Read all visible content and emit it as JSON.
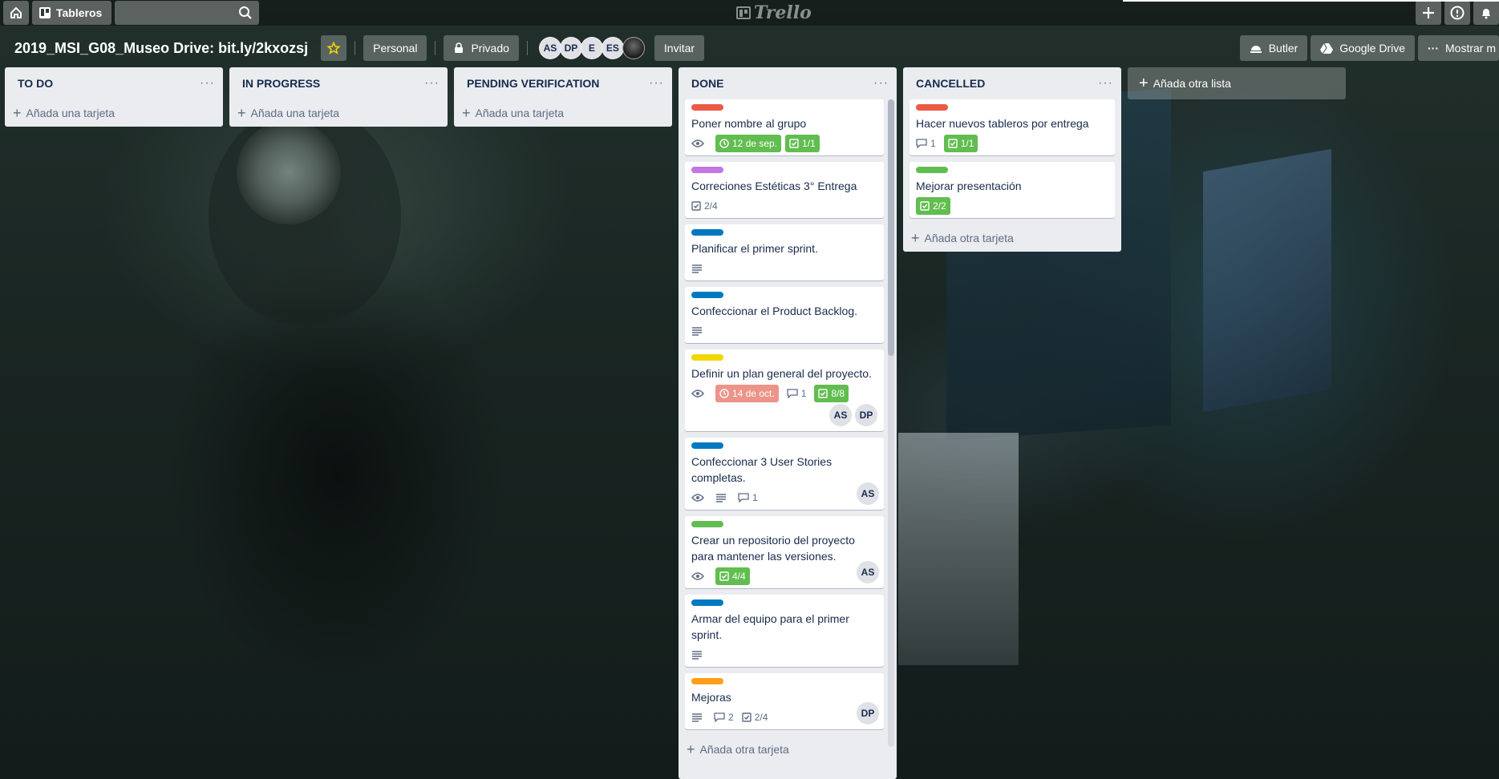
{
  "topbar": {
    "boards_label": "Tableros",
    "search_placeholder": "",
    "logo_text": "Trello"
  },
  "board": {
    "title": "2019_MSI_G08_Museo Drive: bit.ly/2kxozsj",
    "team_label": "Personal",
    "visibility_label": "Privado",
    "members": [
      "AS",
      "DP",
      "E",
      "ES"
    ],
    "invite_label": "Invitar",
    "butler_label": "Butler",
    "drive_label": "Google Drive",
    "menu_label": "Mostrar m"
  },
  "lists": {
    "todo": {
      "title": "TO DO",
      "add_card": "Añada una tarjeta"
    },
    "inprogress": {
      "title": "IN PROGRESS",
      "add_card": "Añada una tarjeta"
    },
    "pending": {
      "title": "PENDING VERIFICATION",
      "add_card": "Añada una tarjeta"
    },
    "done": {
      "title": "DONE",
      "add_card": "Añada otra tarjeta",
      "cards": [
        {
          "title": "Poner nombre al grupo",
          "label_color": "#eb5a46",
          "due": "12 de sep.",
          "checklist": "1/1"
        },
        {
          "title": "Correciones Estéticas 3° Entrega",
          "label_color": "#c377e0",
          "checklist": "2/4"
        },
        {
          "title": "Planificar el primer sprint.",
          "label_color": "#0079bf"
        },
        {
          "title": "Confeccionar el Product Backlog.",
          "label_color": "#0079bf"
        },
        {
          "title": "Definir un plan general del proyecto.",
          "label_color": "#f2d600",
          "due": "14 de oct.",
          "comments": "1",
          "checklist": "8/8",
          "members": [
            "AS",
            "DP"
          ]
        },
        {
          "title": "Confeccionar 3 User Stories completas.",
          "label_color": "#0079bf",
          "comments": "1",
          "members": [
            "AS"
          ]
        },
        {
          "title": "Crear un repositorio del proyecto para mantener las versiones.",
          "label_color": "#61bd4f",
          "checklist": "4/4",
          "members": [
            "AS"
          ]
        },
        {
          "title": "Armar del equipo para el primer sprint.",
          "label_color": "#0079bf"
        },
        {
          "title": "Mejoras",
          "label_color": "#ff9f1a",
          "comments": "2",
          "checklist": "2/4",
          "members": [
            "DP"
          ]
        }
      ]
    },
    "cancelled": {
      "title": "CANCELLED",
      "add_card": "Añada otra tarjeta",
      "cards": [
        {
          "title": "Hacer nuevos tableros por entrega",
          "label_color": "#eb5a46",
          "comments": "1",
          "checklist": "1/1"
        },
        {
          "title": "Mejorar presentación",
          "label_color": "#61bd4f",
          "checklist": "2/2"
        }
      ]
    }
  },
  "add_list_label": "Añada otra lista",
  "list_menu_glyph": "···"
}
